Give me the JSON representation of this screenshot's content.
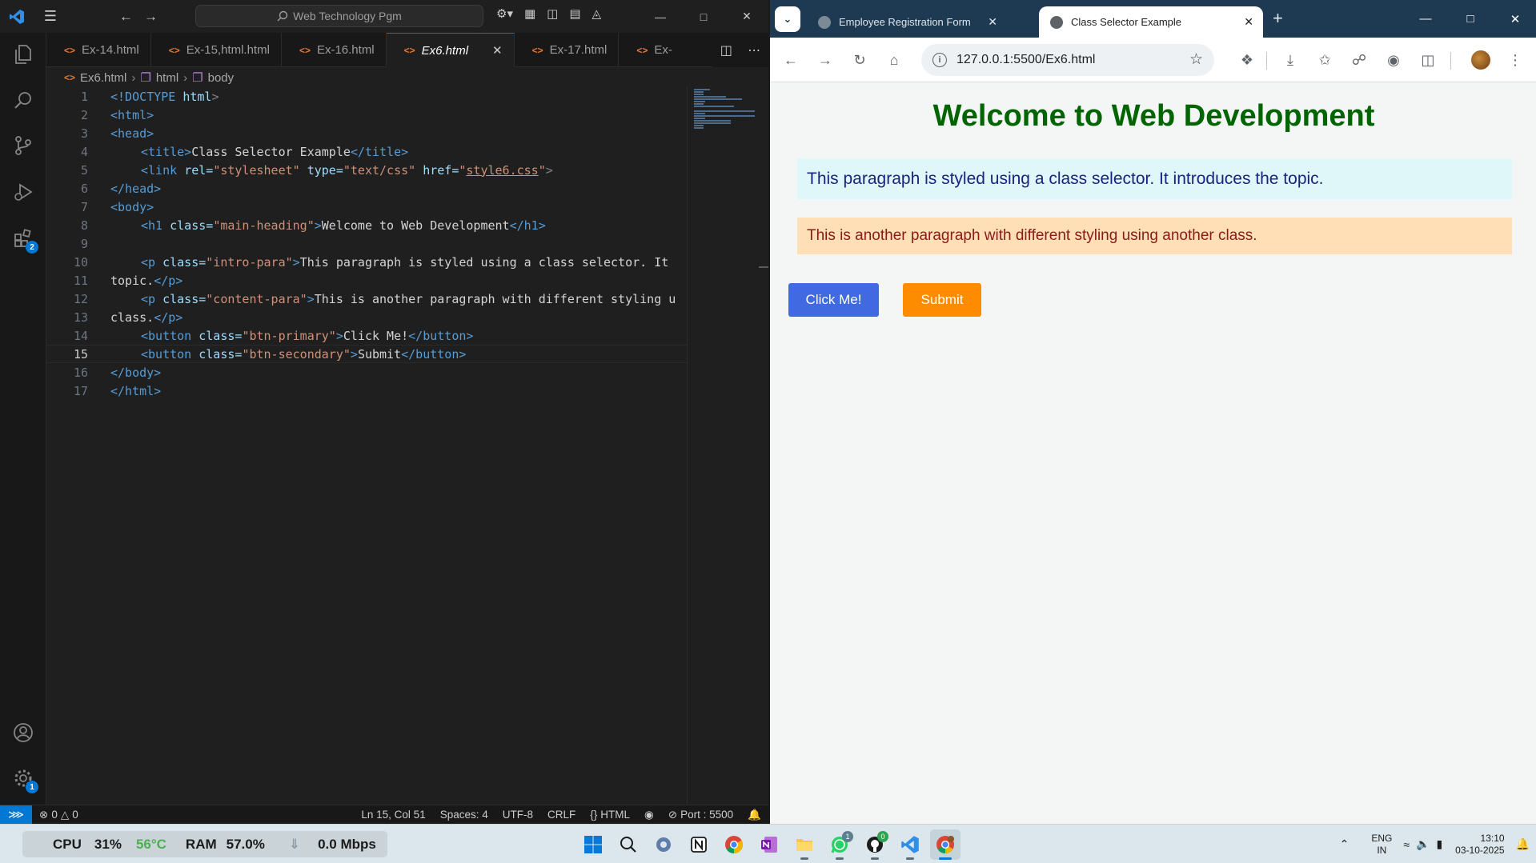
{
  "vscode": {
    "search_text": "Web Technology Pgm",
    "tabs": [
      {
        "label": "Ex-14.html",
        "active": false
      },
      {
        "label": "Ex-15,html.html",
        "active": false
      },
      {
        "label": "Ex-16.html",
        "active": false
      },
      {
        "label": "Ex6.html",
        "active": true
      },
      {
        "label": "Ex-17.html",
        "active": false
      },
      {
        "label": "Ex-",
        "active": false
      }
    ],
    "breadcrumb": [
      "Ex6.html",
      "html",
      "body"
    ],
    "activity_badges": {
      "extensions": "2",
      "settings": "1"
    },
    "line_numbers": [
      "1",
      "2",
      "3",
      "4",
      "5",
      "6",
      "7",
      "8",
      "9",
      "10",
      "11",
      "12",
      "13",
      "14",
      "15",
      "16",
      "17"
    ],
    "current_line": "15",
    "code": {
      "l1_doctype": "<!DOCTYPE",
      "l1_html": "html",
      "l2": "<html>",
      "l3": "<head>",
      "l4_open": "<title>",
      "l4_text": "Class Selector Example",
      "l4_close": "</title>",
      "l5_tag": "<link",
      "l5_rel_attr": "rel=",
      "l5_rel_val": "\"stylesheet\"",
      "l5_type_attr": "type=",
      "l5_type_val": "\"text/css\"",
      "l5_href_attr": "href=",
      "l5_href_q1": "\"",
      "l5_href_val": "style6.css",
      "l5_href_q2": "\"",
      "l5_end": ">",
      "l6": "</head>",
      "l7": "<body>",
      "l8_tag": "<h1",
      "l8_attr": "class=",
      "l8_val": "\"main-heading\"",
      "l8_gt": ">",
      "l8_text": "Welcome to Web Development",
      "l8_close": "</h1>",
      "l10_tag": "<p",
      "l10_attr": "class=",
      "l10_val": "\"intro-para\"",
      "l10_gt": ">",
      "l10_text": "This paragraph is styled using a class selector. It",
      "l11_text": "topic.",
      "l11_close": "</p>",
      "l12_tag": "<p",
      "l12_attr": "class=",
      "l12_val": "\"content-para\"",
      "l12_gt": ">",
      "l12_text": "This is another paragraph with different styling u",
      "l13_text": "class.",
      "l13_close": "</p>",
      "l14_tag": "<button",
      "l14_attr": "class=",
      "l14_val": "\"btn-primary\"",
      "l14_gt": ">",
      "l14_text": "Click Me!",
      "l14_close": "</button>",
      "l15_tag": "<button",
      "l15_attr": "class=",
      "l15_val": "\"btn-secondary\"",
      "l15_gt": ">",
      "l15_text": "Submit",
      "l15_close": "</button>",
      "l16": "</body>",
      "l17": "</html>"
    },
    "status": {
      "errors": "0",
      "warnings": "0",
      "position": "Ln 15, Col 51",
      "spaces": "Spaces: 4",
      "encoding": "UTF-8",
      "eol": "CRLF",
      "language": "HTML",
      "port": "Port : 5500"
    }
  },
  "browser": {
    "tabs": [
      {
        "title": "Employee Registration Form",
        "active": false
      },
      {
        "title": "Class Selector Example",
        "active": true
      }
    ],
    "url": "127.0.0.1:5500/Ex6.html",
    "page": {
      "heading": "Welcome to Web Development",
      "intro_para": "This paragraph is styled using a class selector. It introduces the topic.",
      "content_para": "This is another paragraph with different styling using another class.",
      "primary_button": "Click Me!",
      "secondary_button": "Submit"
    },
    "colors": {
      "heading": "#006400",
      "intro_bg": "#e0f7fa",
      "content_bg": "#ffdfb5",
      "primary_btn": "#4169e1",
      "secondary_btn": "#ff8c00"
    }
  },
  "taskbar": {
    "cpu_label": "CPU",
    "cpu_value": "31%",
    "cpu_temp": "56°C",
    "ram_label": "RAM",
    "ram_value": "57.0%",
    "net_value": "0.0 Mbps",
    "whatsapp_badge": "1",
    "github_badge": "0",
    "lang_top": "ENG",
    "lang_bottom": "IN",
    "time": "13:10",
    "date": "03-10-2025"
  }
}
